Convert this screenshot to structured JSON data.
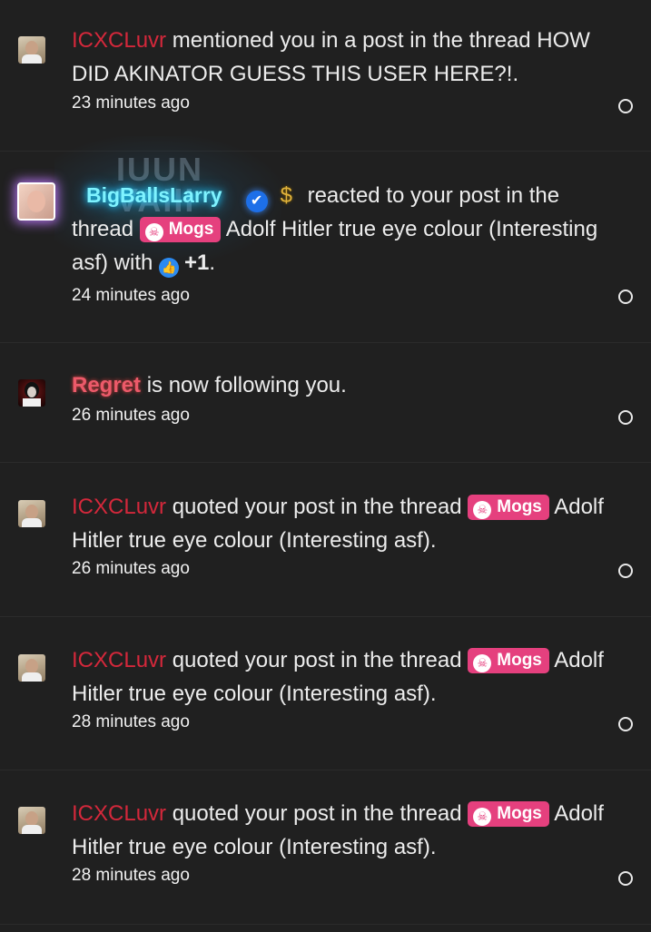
{
  "notifications": [
    {
      "user": "ICXCLuvr",
      "text": "mentioned you in a post in the thread HOW DID AKINATOR GUESS THIS USER HERE?!.",
      "time": "23 minutes ago"
    },
    {
      "user": "BigBallsLarry",
      "text_before": "reacted to your post in the thread",
      "tag": "Mogs",
      "thread": "Adolf Hitler true eye colour (Interesting asf) with",
      "reaction": "+1",
      "suffix": ".",
      "time": "24 minutes ago"
    },
    {
      "user": "Regret",
      "text": "is now following you.",
      "time": "26 minutes ago"
    },
    {
      "user": "ICXCLuvr",
      "text_before": "quoted your post in the thread",
      "tag": "Mogs",
      "thread": "Adolf Hitler true eye colour (Interesting asf).",
      "time": "26 minutes ago"
    },
    {
      "user": "ICXCLuvr",
      "text_before": "quoted your post in the thread",
      "tag": "Mogs",
      "thread": "Adolf Hitler true eye colour (Interesting asf).",
      "time": "28 minutes ago"
    },
    {
      "user": "ICXCLuvr",
      "text_before": "quoted your post in the thread",
      "tag": "Mogs",
      "thread": "Adolf Hitler true eye colour (Interesting asf).",
      "time": "28 minutes ago"
    }
  ],
  "icons": {
    "verified": "verified-badge-icon",
    "dollar": "dollar-icon",
    "skull": "skull-icon",
    "like": "thumbs-up-icon",
    "unread": "unread-dot-icon"
  },
  "colors": {
    "background": "#202020",
    "username_red": "#d4283b",
    "tag_pink": "#e5407e",
    "larry_cyan": "#7ff3ff"
  }
}
